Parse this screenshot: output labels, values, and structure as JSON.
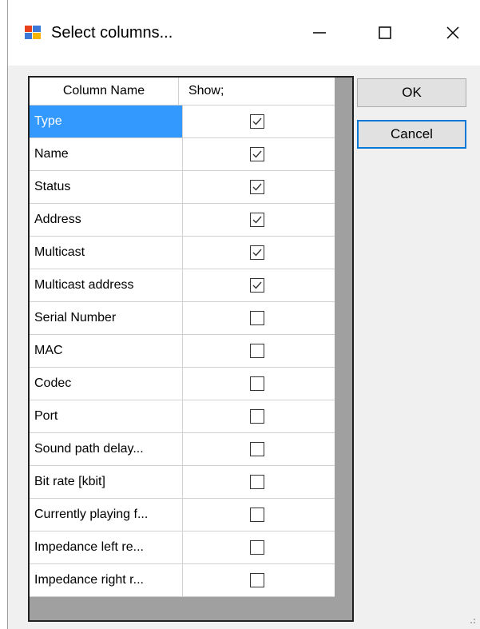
{
  "window": {
    "title": "Select columns...",
    "minimize_icon": "minimize-icon",
    "maximize_icon": "maximize-icon",
    "close_icon": "close-icon"
  },
  "grid": {
    "headers": {
      "name": "Column Name",
      "show": "Show;"
    },
    "rows": [
      {
        "name": "Type",
        "show": true,
        "selected": true
      },
      {
        "name": "Name",
        "show": true
      },
      {
        "name": "Status",
        "show": true
      },
      {
        "name": "Address",
        "show": true
      },
      {
        "name": "Multicast",
        "show": true
      },
      {
        "name": "Multicast address",
        "show": true
      },
      {
        "name": "Serial Number",
        "show": false
      },
      {
        "name": "MAC",
        "show": false
      },
      {
        "name": "Codec",
        "show": false
      },
      {
        "name": "Port",
        "show": false
      },
      {
        "name": "Sound path delay...",
        "show": false
      },
      {
        "name": "Bit rate [kbit]",
        "show": false
      },
      {
        "name": "Currently playing f...",
        "show": false
      },
      {
        "name": "Impedance left re...",
        "show": false
      },
      {
        "name": "Impedance right r...",
        "show": false
      }
    ]
  },
  "buttons": {
    "ok": "OK",
    "cancel": "Cancel"
  },
  "colors": {
    "selection": "#3399ff",
    "focus_border": "#0078d7"
  }
}
